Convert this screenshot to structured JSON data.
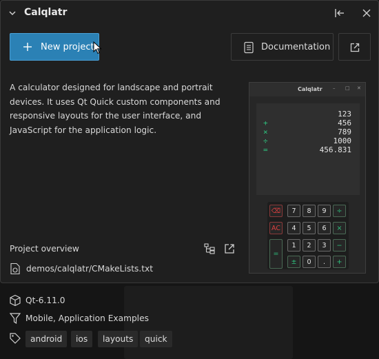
{
  "header": {
    "title": "Calqlatr"
  },
  "actions": {
    "new_project_label": "New project",
    "documentation_label": "Documentation"
  },
  "description": "A calculator designed for landscape and portrait devices. It uses Qt Quick custom components and responsive layouts for the user interface, and JavaScript for the application logic.",
  "preview": {
    "window_title": "Calqlatr",
    "display_lines": [
      {
        "op": "",
        "num": "123"
      },
      {
        "op": "+",
        "num": "456"
      },
      {
        "op": "×",
        "num": "789"
      },
      {
        "op": "÷",
        "num": "1000"
      },
      {
        "op": "=",
        "num": "456.831"
      }
    ],
    "keys": {
      "backspace": "⌫",
      "ac": "AC",
      "equals": "=",
      "k7": "7",
      "k8": "8",
      "k9": "9",
      "div": "÷",
      "k4": "4",
      "k5": "5",
      "k6": "6",
      "mul": "×",
      "k1": "1",
      "k2": "2",
      "k3": "3",
      "sub": "−",
      "sign": "±",
      "k0": "0",
      "dot": ".",
      "add": "+"
    }
  },
  "overview": {
    "label": "Project overview",
    "file_path": "demos/calqlatr/CMakeLists.txt"
  },
  "meta": {
    "qt_version": "Qt-6.11.0",
    "categories": "Mobile,  Application Examples",
    "tags": [
      "android",
      "ios",
      "layouts",
      "quick"
    ]
  },
  "colors": {
    "accent": "#2b81b5",
    "panel_bg": "#1f1f1f",
    "calc_green": "#2ec27e",
    "calc_red": "#e04040"
  }
}
